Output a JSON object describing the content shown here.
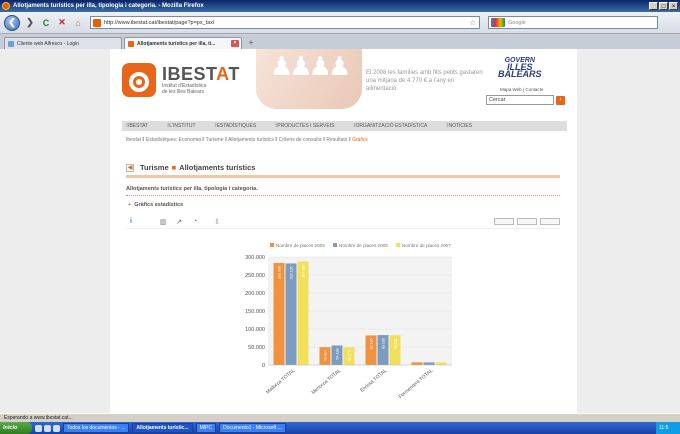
{
  "window": {
    "title": "Allotjaments turístics per illa, tipologia i categoria. - Mozilla Firefox",
    "min": "_",
    "max": "□",
    "close": "×"
  },
  "toolbar": {
    "back": "❮",
    "forward": "❯",
    "reload": "C",
    "stop": "✕",
    "home": "⌂",
    "url": "http://www.ibestat.cat/ibestat/page?p=px_taxi",
    "search_placeholder": "Google"
  },
  "tabs": [
    {
      "label": "Cliente web Alfresco - Login"
    },
    {
      "label": "Allotjaments turístics per illa, ti..."
    }
  ],
  "page": {
    "logo": {
      "name_a": "IBEST",
      "name_b": "A",
      "name_c": "T",
      "sub1": "Institut d'Estadística",
      "sub2": "de les Illes Balears"
    },
    "fact": "El 2008 les famílies amb fills petits gastaren una mitjana de 4.770 € a l'any en alimentació",
    "govern": {
      "l1": "GOVERN",
      "l2": "ILLES",
      "l3": "BALEARS"
    },
    "toplinks": "Mapa Web | Contacte",
    "search_value": "Cercar",
    "nav": [
      "IBESTAT",
      "L'INSTITUT",
      "ESTADÍSTIQUES",
      "PRODUCTES I SERVEIS",
      "ORGANITZACIÓ ESTADÍSTICA",
      "NOTÍCIES"
    ],
    "breadcrumb": "Ibestat ‖ Estadístiques: Economia ‖ Turisme ‖ Allotjaments turístics ‖ Criteris de consulta ‖ Resultats ‖",
    "breadcrumb_current": "Gràfics",
    "section": {
      "a": "Turisme",
      "b": "Allotjaments turístics"
    },
    "subhead": "Allotjaments turístics per illa, tipologia i categoria.",
    "grafics": "Gràfics estadístics"
  },
  "chart_data": {
    "type": "bar",
    "categories": [
      "Mallorca TOTAL",
      "Menorca TOTAL",
      "Eivissa TOTAL",
      "Formentera TOTAL"
    ],
    "series": [
      {
        "name": "Nombre de places 2009",
        "color": "#f0923e",
        "values": [
          283390,
          49424,
          82185,
          7308
        ]
      },
      {
        "name": "Nombre de places 2008",
        "color": "#7b9cc0",
        "values": [
          282136,
          54138,
          83160,
          7308
        ]
      },
      {
        "name": "Nombre de places 2007",
        "color": "#f2e05a",
        "values": [
          287410,
          49275,
          82621,
          7308
        ]
      }
    ],
    "yticks": [
      "300.000",
      "250.000",
      "200.000",
      "150.000",
      "100.000",
      "50.000",
      "0"
    ],
    "ylim": [
      0,
      300000
    ]
  },
  "status": "Esperando a www.ibestat.cat...",
  "taskbar": {
    "start": "Inicio",
    "items": [
      "Todos los documentos - ...",
      "Allotjaments turístic...",
      "MIPC",
      "Documento1 - Microsoft ..."
    ],
    "clock": "11:5"
  }
}
